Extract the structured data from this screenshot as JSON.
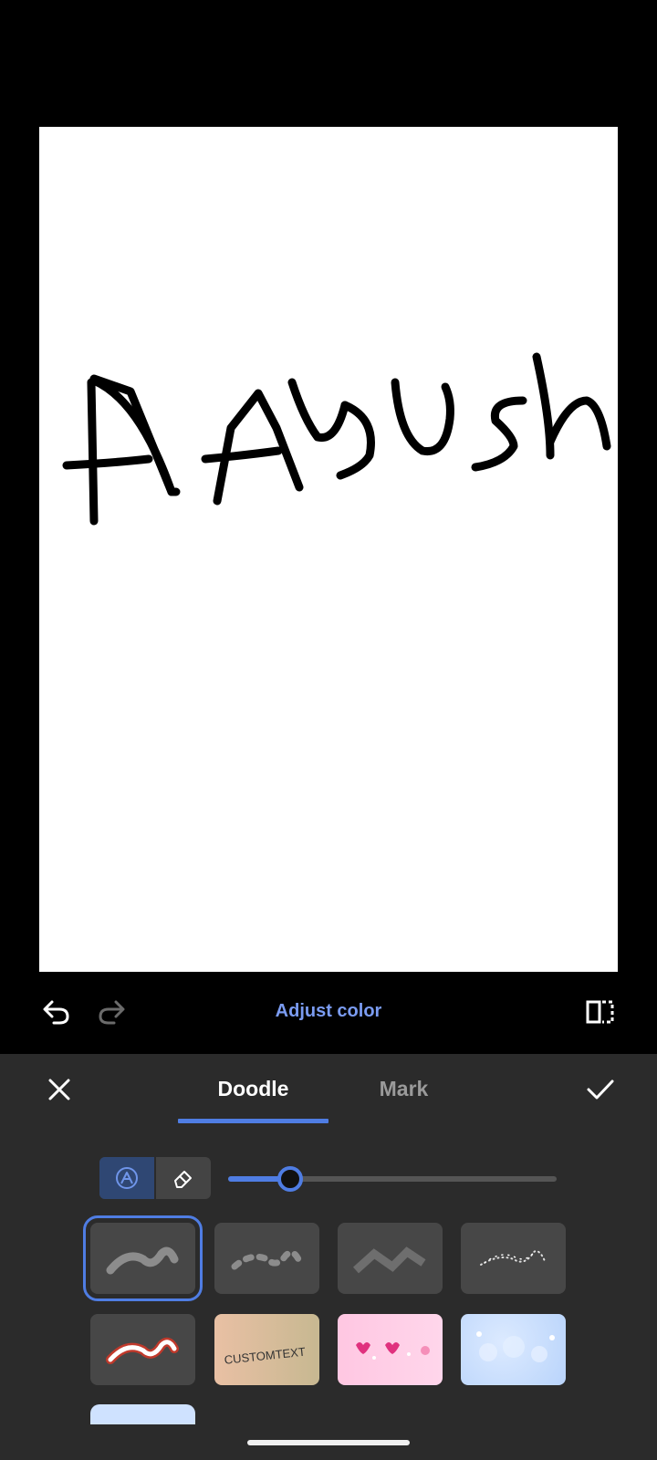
{
  "toolbar": {
    "adjust_color_label": "Adjust color",
    "undo_icon": "undo-icon",
    "redo_icon": "redo-icon",
    "compare_icon": "compare-icon"
  },
  "canvas": {
    "drawn_text": "AAyush",
    "background": "#ffffff",
    "stroke_color": "#000000"
  },
  "panel": {
    "close_icon": "close-icon",
    "confirm_icon": "check-icon",
    "tabs": [
      {
        "label": "Doodle",
        "active": true
      },
      {
        "label": "Mark",
        "active": false
      }
    ],
    "tools": [
      {
        "name": "brush",
        "active": true
      },
      {
        "name": "eraser",
        "active": false
      }
    ],
    "brush_size_fraction": 0.19,
    "brushes": [
      {
        "name": "solid",
        "selected": true
      },
      {
        "name": "dashed",
        "selected": false
      },
      {
        "name": "marker",
        "selected": false
      },
      {
        "name": "sparkle",
        "selected": false
      },
      {
        "name": "neon-red",
        "selected": false
      },
      {
        "name": "custom-text",
        "selected": false,
        "label": "CUSTOMTEXT"
      },
      {
        "name": "hearts",
        "selected": false
      },
      {
        "name": "bubbles",
        "selected": false
      }
    ]
  },
  "colors": {
    "accent": "#4f7de3",
    "panel_bg": "#2b2b2b",
    "link": "#7b9cf2"
  }
}
